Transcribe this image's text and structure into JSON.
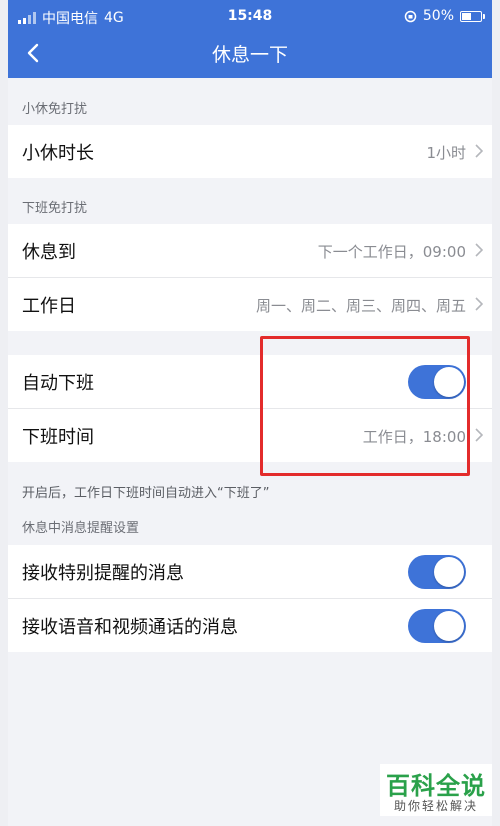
{
  "status_bar": {
    "carrier": "中国电信",
    "network": "4G",
    "time": "15:48",
    "battery": "50%",
    "battery_level": 0.5
  },
  "header": {
    "title": "休息一下",
    "back_icon": "chevron-left-icon"
  },
  "section_short_break": {
    "label": "小休免打扰",
    "rows": [
      {
        "label": "小休时长",
        "value": "1小时"
      }
    ]
  },
  "section_off_work": {
    "label": "下班免打扰",
    "rows": [
      {
        "label": "休息到",
        "value": "下一个工作日，09:00"
      },
      {
        "label": "工作日",
        "value": "周一、周二、周三、周四、周五"
      }
    ]
  },
  "section_auto": {
    "rows": [
      {
        "label": "自动下班",
        "toggle_on": true
      },
      {
        "label": "下班时间",
        "value": "工作日，18:00"
      }
    ],
    "note": "开启后，工作日下班时间自动进入“下班了”"
  },
  "section_messages": {
    "label": "休息中消息提醒设置",
    "rows": [
      {
        "label": "接收特别提醒的消息",
        "toggle_on": true
      },
      {
        "label": "接收语音和视频通话的消息",
        "toggle_on": true
      }
    ]
  },
  "watermark": {
    "title": "百科全说",
    "subtitle": "助你轻松解决"
  },
  "colors": {
    "accent": "#3e73d8",
    "highlight": "#e32b2b",
    "brand": "#2aa14a"
  }
}
